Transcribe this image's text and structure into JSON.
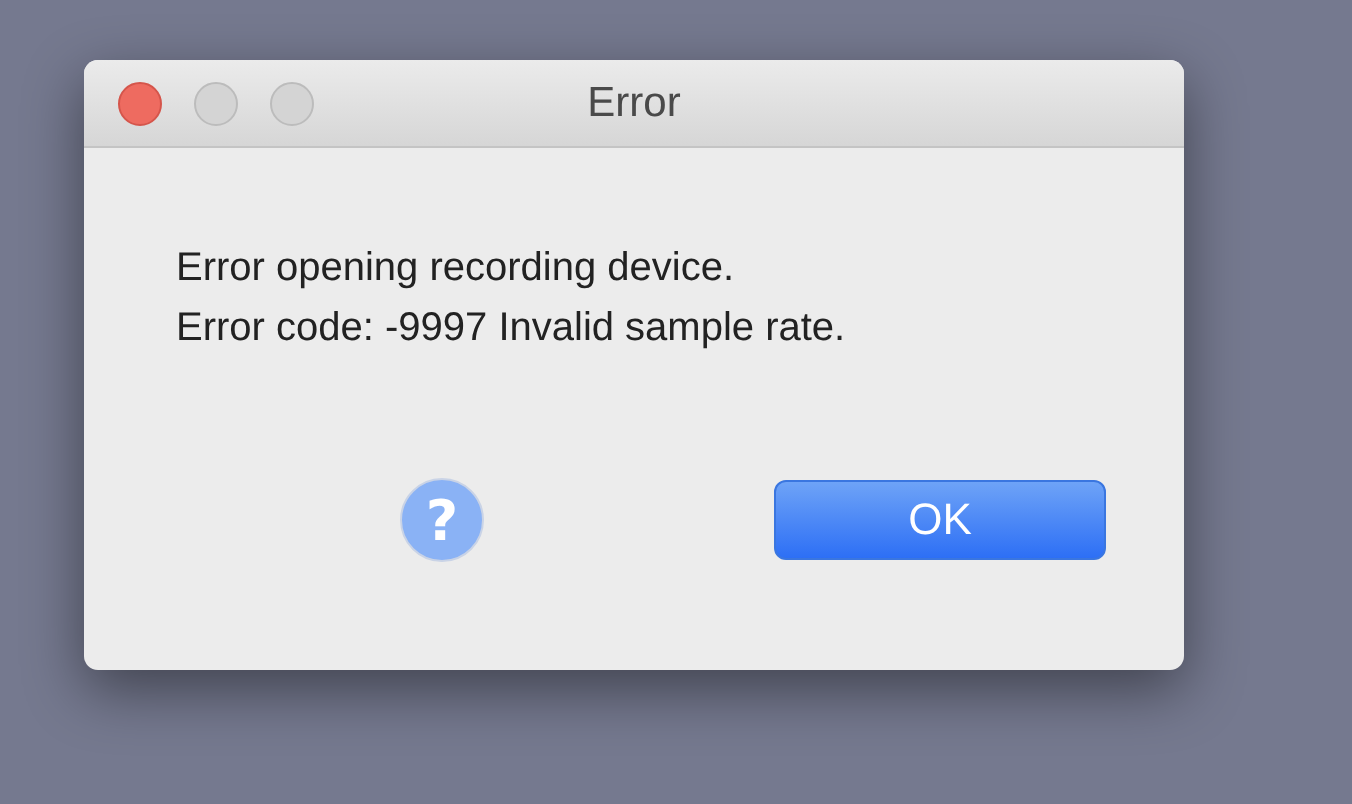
{
  "window": {
    "title": "Error"
  },
  "message": [
    "Error opening recording device.",
    "Error code: -9997 Invalid sample rate."
  ],
  "help_button": {
    "label": "?"
  },
  "buttons": [
    {
      "label": "OK",
      "default": true
    }
  ]
}
